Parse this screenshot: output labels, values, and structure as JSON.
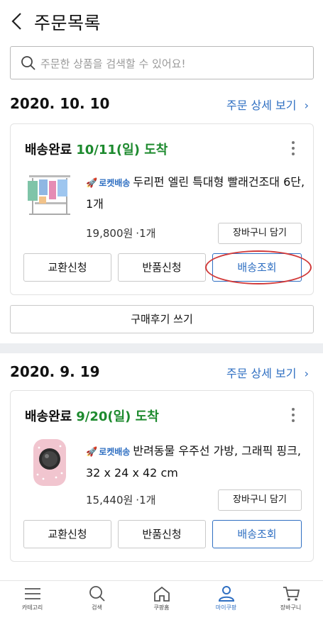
{
  "header": {
    "title": "주문목록"
  },
  "search": {
    "placeholder": "주문한 상품을 검색할 수 있어요!"
  },
  "orders": [
    {
      "date": "2020. 10. 10",
      "detail_link": "주문 상세 보기",
      "status": "배송완료",
      "arrival": "10/11(일) 도착",
      "rocket_label": "로켓배송",
      "product_name": "두리펀 엘린 특대형 빨래건조대 6단, 1개",
      "price": "19,800원",
      "quantity": "1개",
      "cart_button": "장바구니 담기",
      "buttons": [
        "교환신청",
        "반품신청",
        "배송조회"
      ],
      "review_button": "구매후기 쓰기"
    },
    {
      "date": "2020. 9. 19",
      "detail_link": "주문 상세 보기",
      "status": "배송완료",
      "arrival": "9/20(일) 도착",
      "rocket_label": "로켓배송",
      "product_name": "반려동물 우주선 가방, 그래픽 핑크, 32 x 24 x 42 cm",
      "price": "15,440원",
      "quantity": "1개",
      "cart_button": "장바구니 담기",
      "buttons": [
        "교환신청",
        "반품신청",
        "배송조회"
      ]
    }
  ],
  "bottom_nav": [
    {
      "label": "카테고리",
      "icon": "menu-icon"
    },
    {
      "label": "검색",
      "icon": "search-icon"
    },
    {
      "label": "쿠팡홈",
      "icon": "home-icon"
    },
    {
      "label": "마이쿠팡",
      "icon": "user-icon",
      "active": true
    },
    {
      "label": "장바구니",
      "icon": "cart-icon"
    }
  ],
  "colors": {
    "accent": "#2f6fc2",
    "arrival": "#1d8a2e",
    "highlight": "#d13a3a"
  }
}
